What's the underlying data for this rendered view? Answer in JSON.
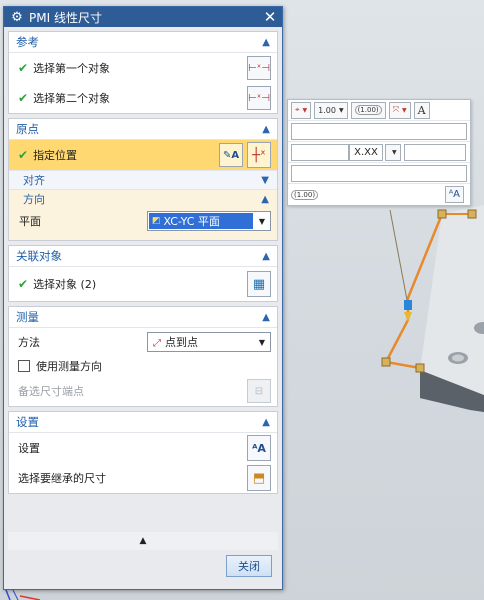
{
  "dialog": {
    "title": "PMI 线性尺寸",
    "close_glyph": "✕",
    "groups": {
      "reference": {
        "header": "参考",
        "items": [
          {
            "label": "选择第一个对象",
            "icon": "dimension-endpoint-icon"
          },
          {
            "label": "选择第二个对象",
            "icon": "dimension-endpoint-icon"
          }
        ]
      },
      "origin": {
        "header": "原点",
        "specify_location": "指定位置",
        "align_label": "对齐",
        "direction_label": "方向",
        "plane_label": "平面",
        "plane_value": "XC-YC 平面"
      },
      "associated": {
        "header": "关联对象",
        "select_objects": "选择对象 (2)"
      },
      "measure": {
        "header": "测量",
        "method_label": "方法",
        "method_value": "点到点",
        "use_measure_direction": "使用测量方向",
        "alternate_endpoint": "备选尺寸端点"
      },
      "settings": {
        "header": "设置",
        "settings_label": "设置",
        "inherit_label": "选择要继承的尺寸"
      }
    },
    "close_button": "关闭",
    "collapse_glyph": "▲"
  },
  "float_toolbar": {
    "precision_value": "1.00",
    "tolerance_badge": "(1.00)",
    "format_value": "X.XX",
    "text_a": "A",
    "row4_badge": "(1.00)"
  },
  "colors": {
    "titlebar": "#2d5c96",
    "group_header_text": "#1f5ea8",
    "active_row": "#ffd872",
    "selection": "#2f6fd6",
    "check": "#2aa43a",
    "model_edge": "#e8892b"
  }
}
